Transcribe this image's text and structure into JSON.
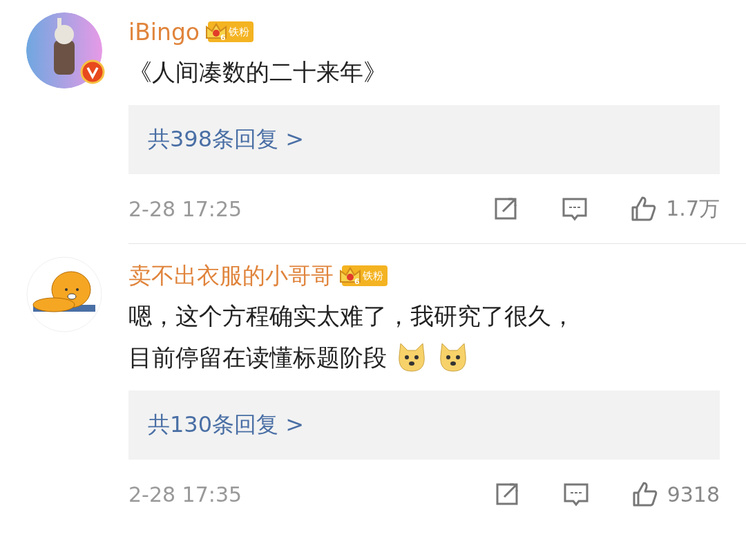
{
  "comments": [
    {
      "avatar": {
        "kind": "rabbit",
        "verified": true
      },
      "name": "iBingo",
      "badge": {
        "level": "6",
        "label": "铁粉"
      },
      "lines": [
        "《人间凑数的二十来年》"
      ],
      "replies": "共398条回复 >",
      "time": "2-28 17:25",
      "likes": "1.7万"
    },
    {
      "avatar": {
        "kind": "bear",
        "verified": false
      },
      "name": "卖不出衣服的小哥哥",
      "badge": {
        "level": "6",
        "label": "铁粉"
      },
      "lines": [
        "嗯，这个方程确实太难了，我研究了很久，",
        "目前停留在读懂标题阶段"
      ],
      "emojis": [
        {
          "kind": "doge"
        },
        {
          "kind": "doge"
        }
      ],
      "replies": "共130条回复 >",
      "time": "2-28 17:35",
      "likes": "9318"
    }
  ]
}
